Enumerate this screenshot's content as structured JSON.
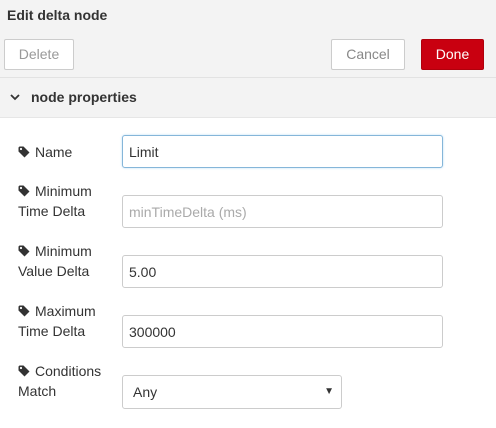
{
  "dialog": {
    "title": "Edit delta node"
  },
  "toolbar": {
    "delete_label": "Delete",
    "cancel_label": "Cancel",
    "done_label": "Done"
  },
  "section": {
    "title": "node properties",
    "icon": "chevron-down-icon"
  },
  "fields": {
    "name": {
      "label": "Name",
      "value": "Limit",
      "icon": "tag-icon"
    },
    "min_time": {
      "label_line1": "Minimum",
      "label_line2": "Time Delta",
      "value": "",
      "placeholder": "minTimeDelta (ms)",
      "icon": "tag-icon"
    },
    "min_value": {
      "label_line1": "Minimum",
      "label_line2": "Value Delta",
      "value": "5.00",
      "icon": "tag-icon"
    },
    "max_time": {
      "label_line1": "Maximum",
      "label_line2": "Time Delta",
      "value": "300000",
      "icon": "tag-icon"
    },
    "conditions": {
      "label_line1": "Conditions",
      "label_line2": "Match",
      "selected": "Any",
      "icon": "tag-icon"
    }
  },
  "colors": {
    "done_button": "#c90010",
    "focus_border": "#85b6d9",
    "header_bg": "#f3f3f3"
  }
}
